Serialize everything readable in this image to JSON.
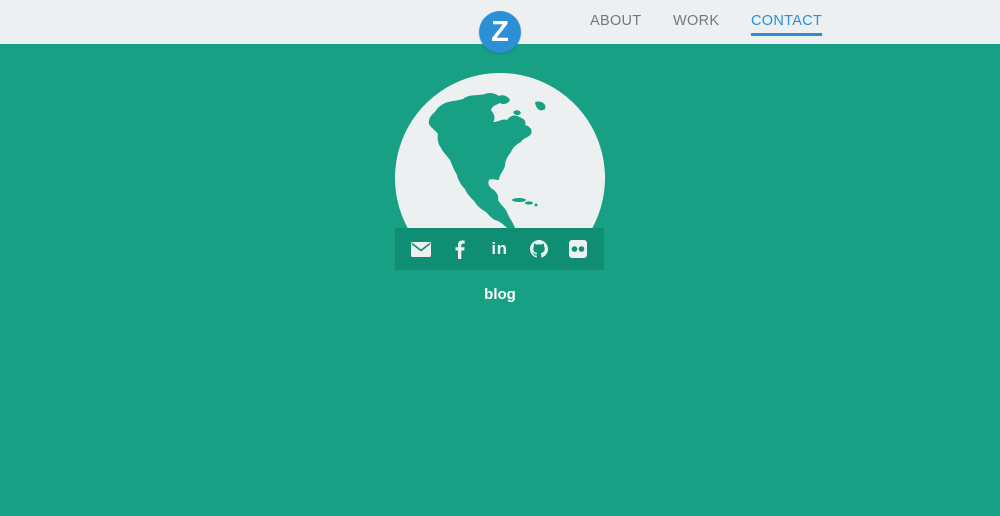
{
  "header": {
    "logo_letter": "Z",
    "nav": {
      "about": "ABOUT",
      "work": "WORK",
      "contact": "CONTACT"
    },
    "active_item": "CONTACT"
  },
  "main": {
    "globe_icon": "globe-americas-icon",
    "social_icons": [
      "mail-icon",
      "facebook-icon",
      "linkedin-icon",
      "github-icon",
      "flickr-icon"
    ],
    "linkedin_text": "in",
    "blog_label": "blog"
  },
  "colors": {
    "background": "#17a084",
    "topbar": "#edf0f1",
    "accent": "#2a8fd3",
    "nav_text": "#6f7a80",
    "social_bar": "#0f8e73",
    "globe": "#edf0f1"
  }
}
